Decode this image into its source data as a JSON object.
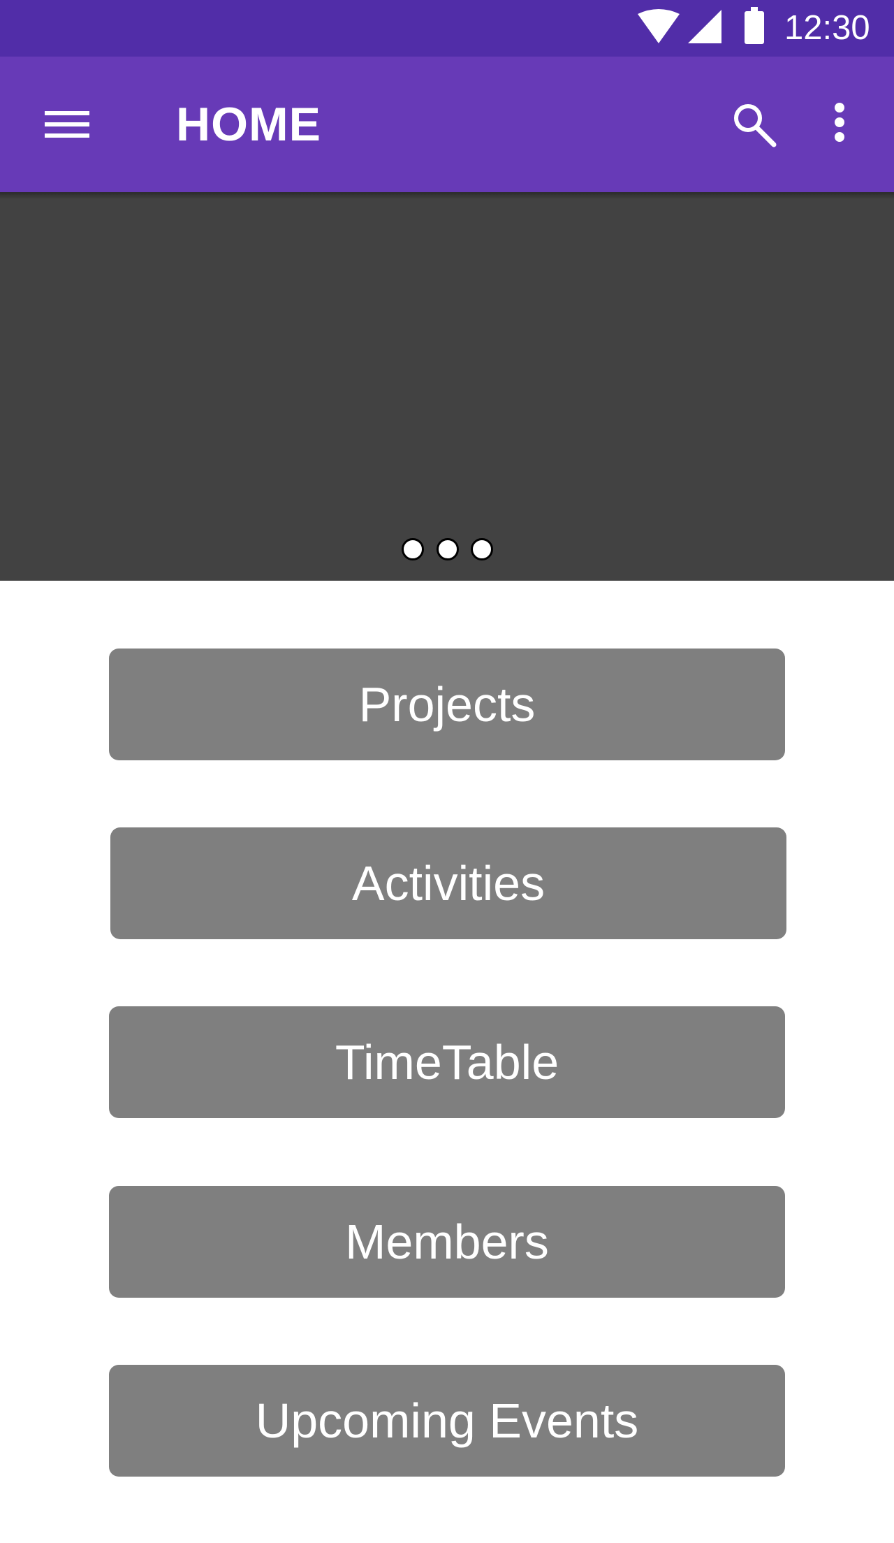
{
  "status_bar": {
    "time": "12:30",
    "icons": [
      "wifi-icon",
      "cell-signal-icon",
      "battery-icon"
    ]
  },
  "app_bar": {
    "title": "HOME",
    "icons": [
      "menu-icon",
      "search-icon",
      "more-vert-icon"
    ]
  },
  "carousel": {
    "page_count": 3
  },
  "menu": {
    "projects_label": "Projects",
    "activities_label": "Activities",
    "timetable_label": "TimeTable",
    "members_label": "Members",
    "upcoming_events_label": "Upcoming Events"
  },
  "colors": {
    "status_bar": "#512DA8",
    "app_bar": "#673AB7",
    "carousel": "#424242",
    "button": "#7f7f7f",
    "text_on_color": "#ffffff"
  }
}
